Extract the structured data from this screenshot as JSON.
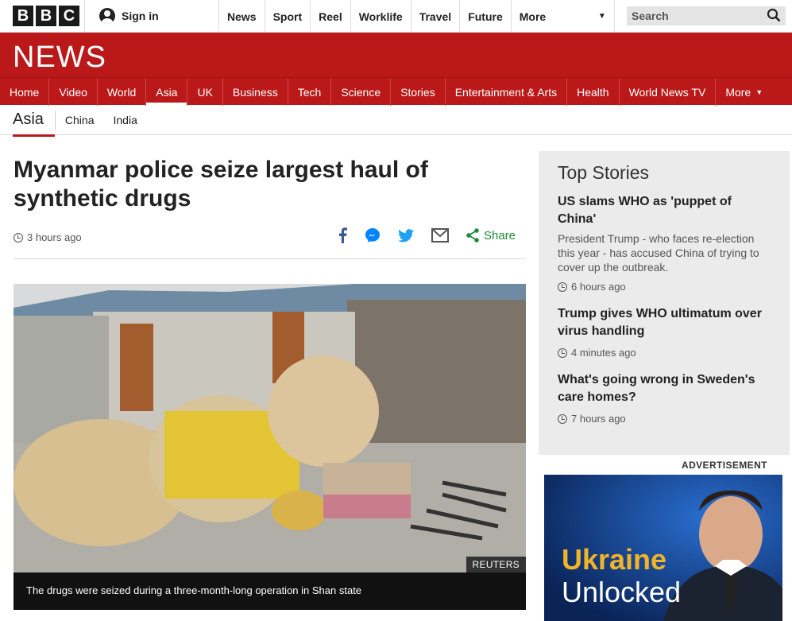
{
  "topbar": {
    "logo": [
      "B",
      "B",
      "C"
    ],
    "signin": "Sign in",
    "nav": [
      "News",
      "Sport",
      "Reel",
      "Worklife",
      "Travel",
      "Future"
    ],
    "more": "More",
    "search": "Search"
  },
  "banner": {
    "title": "NEWS"
  },
  "mainnav": [
    "Home",
    "Video",
    "World",
    "Asia",
    "UK",
    "Business",
    "Tech",
    "Science",
    "Stories",
    "Entertainment & Arts",
    "Health",
    "World News TV",
    "More"
  ],
  "mainnav_active": "Asia",
  "subnav": {
    "current": "Asia",
    "items": [
      "China",
      "India"
    ]
  },
  "article": {
    "headline": "Myanmar police seize largest haul of synthetic drugs",
    "timestamp": "3 hours ago",
    "share_label": "Share",
    "share_icons": [
      "facebook-icon",
      "messenger-icon",
      "twitter-icon",
      "email-icon",
      "share-icon"
    ],
    "image_credit": "REUTERS",
    "caption": "The drugs were seized during a three-month-long operation in Shan state"
  },
  "top_stories": {
    "title": "Top Stories",
    "items": [
      {
        "headline": "US slams WHO as 'puppet of China'",
        "summary": "President Trump - who faces re-election this year - has accused China of trying to cover up the outbreak.",
        "time": "6 hours ago"
      },
      {
        "headline": "Trump gives WHO ultimatum over virus handling",
        "summary": "",
        "time": "4 minutes ago"
      },
      {
        "headline": "What's going wrong in Sweden's care homes?",
        "summary": "",
        "time": "7 hours ago"
      }
    ]
  },
  "advertisement": {
    "label": "ADVERTISEMENT",
    "line1": "Ukraine",
    "line2": "Unlocked"
  },
  "colors": {
    "bbc_red": "#bb1919",
    "share_green": "#1c8a3a"
  }
}
